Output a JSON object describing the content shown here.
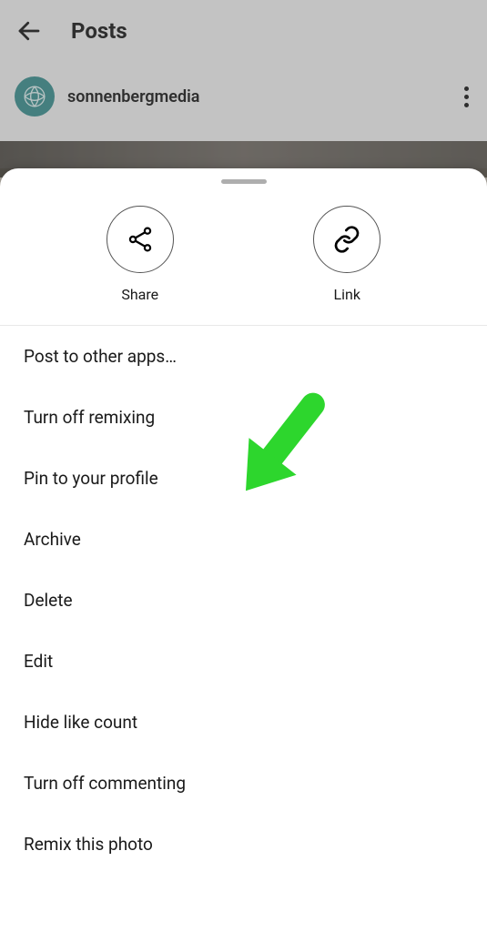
{
  "header": {
    "title": "Posts",
    "username": "sonnenbergmedia"
  },
  "actions": {
    "share": {
      "label": "Share"
    },
    "link": {
      "label": "Link"
    }
  },
  "menu": {
    "items": [
      "Post to other apps…",
      "Turn off remixing",
      "Pin to your profile",
      "Archive",
      "Delete",
      "Edit",
      "Hide like count",
      "Turn off commenting",
      "Remix this photo"
    ]
  }
}
